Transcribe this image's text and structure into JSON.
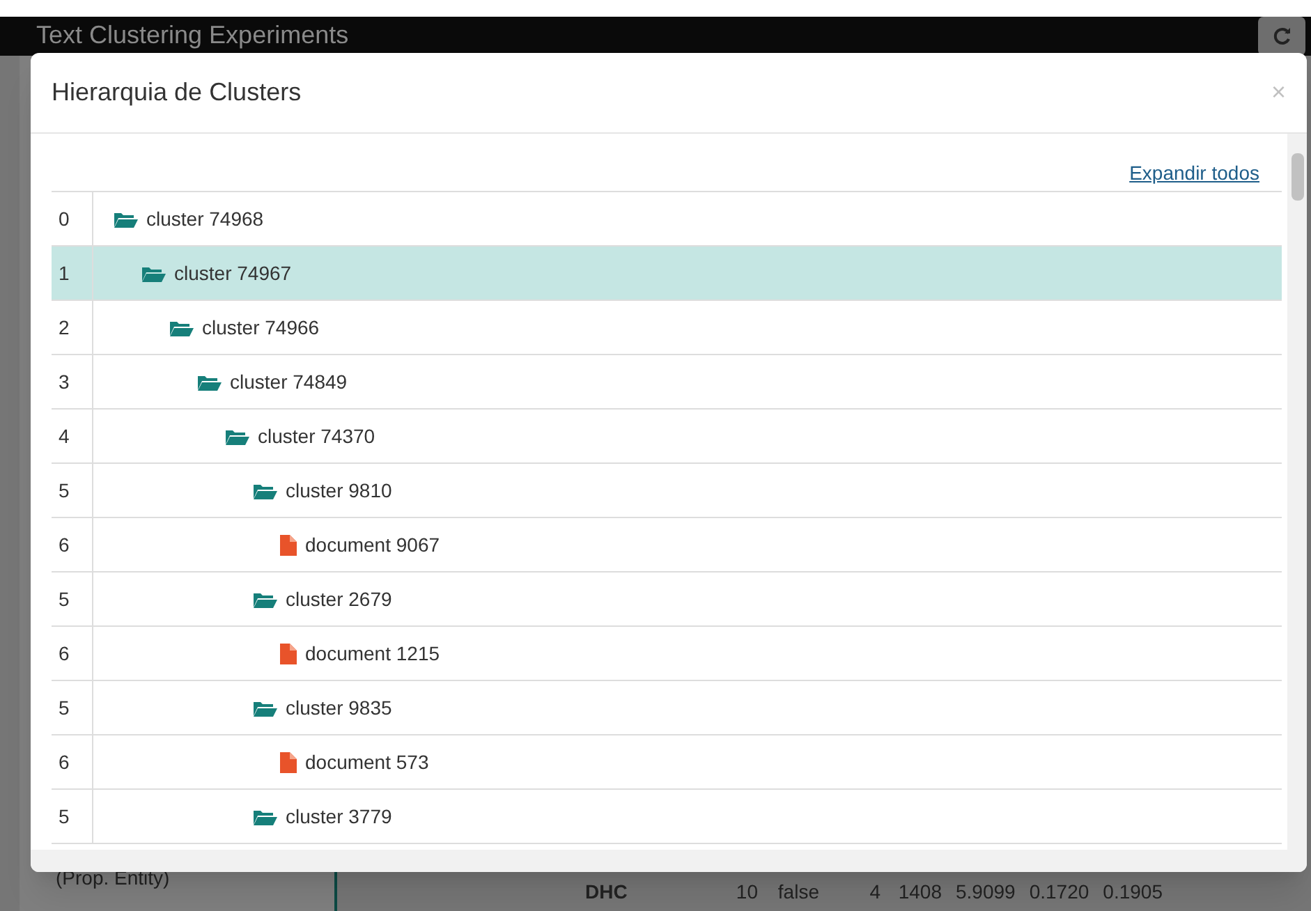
{
  "app": {
    "title": "Text Clustering Experiments",
    "sidebar_text": "(Prop. Entity)",
    "table_row": [
      "DHC",
      "10",
      "false",
      "4",
      "1408",
      "5.9099",
      "0.1720",
      "0.1905"
    ]
  },
  "modal": {
    "title": "Hierarquia de Clusters",
    "close": "×",
    "expand_all": "Expandir todos",
    "tree": [
      {
        "number": "0",
        "kind": "cluster",
        "label": "cluster 74968",
        "selected": false,
        "children": [
          {
            "number": "1",
            "kind": "cluster",
            "label": "cluster 74967",
            "selected": true,
            "children": [
              {
                "number": "2",
                "kind": "cluster",
                "label": "cluster 74966",
                "selected": false,
                "children": [
                  {
                    "number": "3",
                    "kind": "cluster",
                    "label": "cluster 74849",
                    "selected": false,
                    "children": [
                      {
                        "number": "4",
                        "kind": "cluster",
                        "label": "cluster 74370",
                        "selected": false,
                        "children": [
                          {
                            "number": "5",
                            "kind": "cluster",
                            "label": "cluster 9810",
                            "selected": false,
                            "children": [
                              {
                                "number": "6",
                                "kind": "document",
                                "label": "document 9067",
                                "selected": false
                              }
                            ]
                          },
                          {
                            "number": "5",
                            "kind": "cluster",
                            "label": "cluster 2679",
                            "selected": false,
                            "children": [
                              {
                                "number": "6",
                                "kind": "document",
                                "label": "document 1215",
                                "selected": false
                              }
                            ]
                          },
                          {
                            "number": "5",
                            "kind": "cluster",
                            "label": "cluster 9835",
                            "selected": false,
                            "children": [
                              {
                                "number": "6",
                                "kind": "document",
                                "label": "document 573",
                                "selected": false
                              }
                            ]
                          },
                          {
                            "number": "5",
                            "kind": "cluster",
                            "label": "cluster 3779",
                            "selected": false
                          }
                        ]
                      }
                    ]
                  }
                ]
              }
            ]
          }
        ]
      }
    ]
  }
}
